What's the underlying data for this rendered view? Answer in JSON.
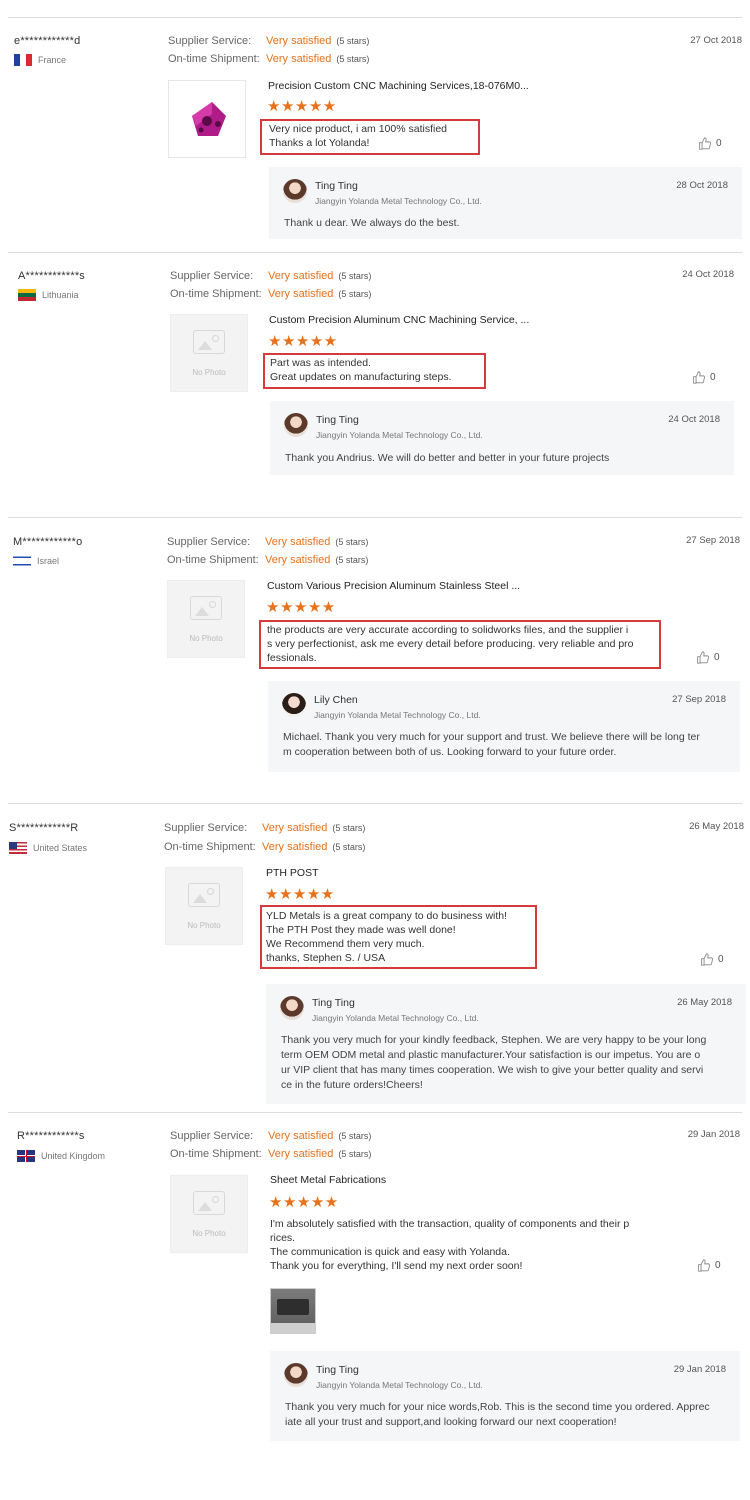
{
  "labels": {
    "supplier_service": "Supplier Service:",
    "on_time_shipment": "On-time Shipment:",
    "very_satisfied": "Very satisfied",
    "five_stars": "(5 stars)",
    "no_photo": "No Photo"
  },
  "colors": {
    "accent": "#e8711a",
    "highlight_border": "#d73a3a",
    "reply_bg": "#f4f6f8"
  },
  "reviews": [
    {
      "buyer": "e************d",
      "country": "France",
      "date": "27 Oct 2018",
      "product": "Precision Custom CNC Machining Services,18-076M0...",
      "rating_stars": 5,
      "comment": "Very nice product, i am 100% satisfied\nThanks a lot Yolanda!",
      "likes": "0",
      "reply": {
        "name": "Ting Ting",
        "company": "Jiangyin Yolanda Metal Technology Co., Ltd.",
        "date": "28 Oct 2018",
        "text": "Thank u dear. We always do the best."
      }
    },
    {
      "buyer": "A************s",
      "country": "Lithuania",
      "date": "24 Oct 2018",
      "product": "Custom Precision Aluminum CNC Machining Service, ...",
      "rating_stars": 5,
      "comment": "Part was as intended.\nGreat updates on manufacturing steps.",
      "likes": "0",
      "reply": {
        "name": "Ting Ting",
        "company": "Jiangyin Yolanda Metal Technology Co., Ltd.",
        "date": "24 Oct 2018",
        "text": "Thank you Andrius. We will do better and better in your future projects"
      }
    },
    {
      "buyer": "M************o",
      "country": "Israel",
      "date": "27 Sep 2018",
      "product": "Custom Various Precision Aluminum Stainless Steel ...",
      "rating_stars": 5,
      "comment": "the products are very accurate according to solidworks files, and the supplier i\ns very perfectionist, ask me every detail before producing. very reliable and pro\nfessionals.",
      "likes": "0",
      "reply": {
        "name": "Lily Chen",
        "company": "Jiangyin Yolanda Metal Technology Co., Ltd.",
        "date": "27 Sep 2018",
        "text": "Michael. Thank you very much for your support and trust. We believe there will be long ter\nm cooperation between both of us. Looking forward to your future order."
      }
    },
    {
      "buyer": "S************R",
      "country": "United States",
      "date": "26 May 2018",
      "product": "PTH POST",
      "rating_stars": 5,
      "comment": "YLD Metals is a great company to do business with!\nThe PTH Post they made was well done!\nWe Recommend them very much.\nthanks, Stephen S. / USA",
      "likes": "0",
      "reply": {
        "name": "Ting Ting",
        "company": "Jiangyin Yolanda Metal Technology Co., Ltd.",
        "date": "26 May 2018",
        "text": "Thank you very much for your kindly feedback, Stephen. We are very happy to be your long\nterm OEM ODM metal and plastic manufacturer.Your satisfaction is our impetus. You are o\nur VIP client that has many times cooperation. We wish to give your better quality and servi\nce in the future orders!Cheers!"
      }
    },
    {
      "buyer": "R************s",
      "country": "United Kingdom",
      "date": "29 Jan 2018",
      "product": "Sheet Metal Fabrications",
      "rating_stars": 5,
      "comment": "I'm absolutely satisfied with the transaction, quality of components and their p\nrices.\nThe communication is quick and easy with Yolanda.\nThank you for everything, I'll send my next order soon!",
      "likes": "0",
      "reply": {
        "name": "Ting Ting",
        "company": "Jiangyin Yolanda Metal Technology Co., Ltd.",
        "date": "29 Jan 2018",
        "text": "Thank you very much for your nice words,Rob. This is the second time you ordered. Apprec\niate all your trust and support,and looking forward our next cooperation!"
      }
    }
  ]
}
